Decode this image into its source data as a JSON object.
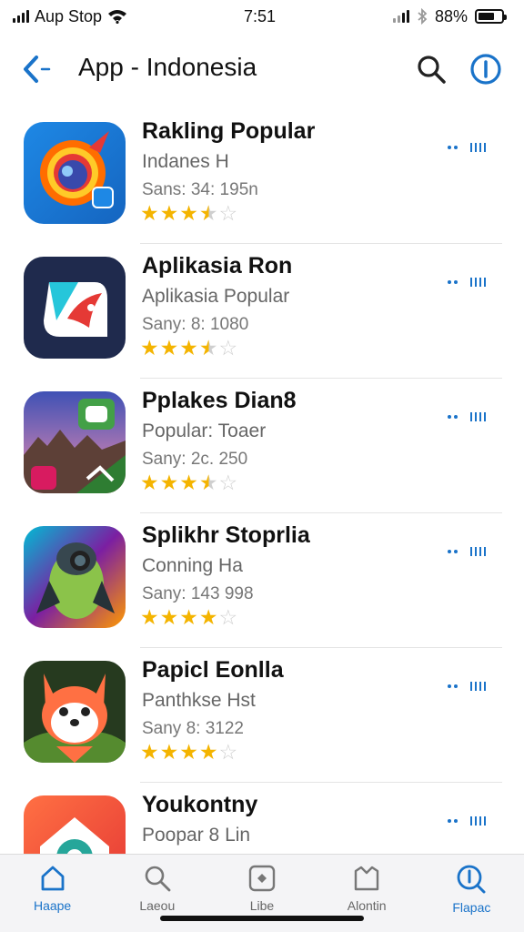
{
  "status_bar": {
    "carrier": "Aup Stop",
    "time": "7:51",
    "battery_text": "88%"
  },
  "nav": {
    "title": "App - Indonesia",
    "icons": [
      "back-chevron-icon",
      "search-icon",
      "info-icon"
    ]
  },
  "colors": {
    "accent": "#1a73c9",
    "star": "#f4b400",
    "star_empty": "#cfcfcf"
  },
  "apps": [
    {
      "name": "Rakling Popular",
      "subtitle": "Indanes H",
      "meta": "Sans: 34: 195n",
      "rating": 3.5
    },
    {
      "name": "Aplikasia Ron",
      "subtitle": "Aplikasia Popular",
      "meta": "Sany: 8: 1080",
      "rating": 3.5
    },
    {
      "name": "Pplakes Dian8",
      "subtitle": "Popular: Toaer",
      "meta": "Sany: 2c. 250",
      "rating": 3.5
    },
    {
      "name": "Splikhr Stoprlia",
      "subtitle": "Conning Ha",
      "meta": "Sany: 143 998",
      "rating": 4
    },
    {
      "name": "Papicl Eonlla",
      "subtitle": "Panthkse Hst",
      "meta": "Sany 8: 3122",
      "rating": 4
    },
    {
      "name": "Youkontny",
      "subtitle": "Poopar 8 Lin",
      "meta": "",
      "rating": 0
    }
  ],
  "tabs": [
    {
      "label": "Haape",
      "icon": "home-icon",
      "active": true
    },
    {
      "label": "Laeou",
      "icon": "search-icon",
      "active": false
    },
    {
      "label": "Libe",
      "icon": "apps-icon",
      "active": false
    },
    {
      "label": "Alontin",
      "icon": "book-icon",
      "active": false
    },
    {
      "label": "Flapac",
      "icon": "search-circle-icon",
      "active": true
    }
  ]
}
